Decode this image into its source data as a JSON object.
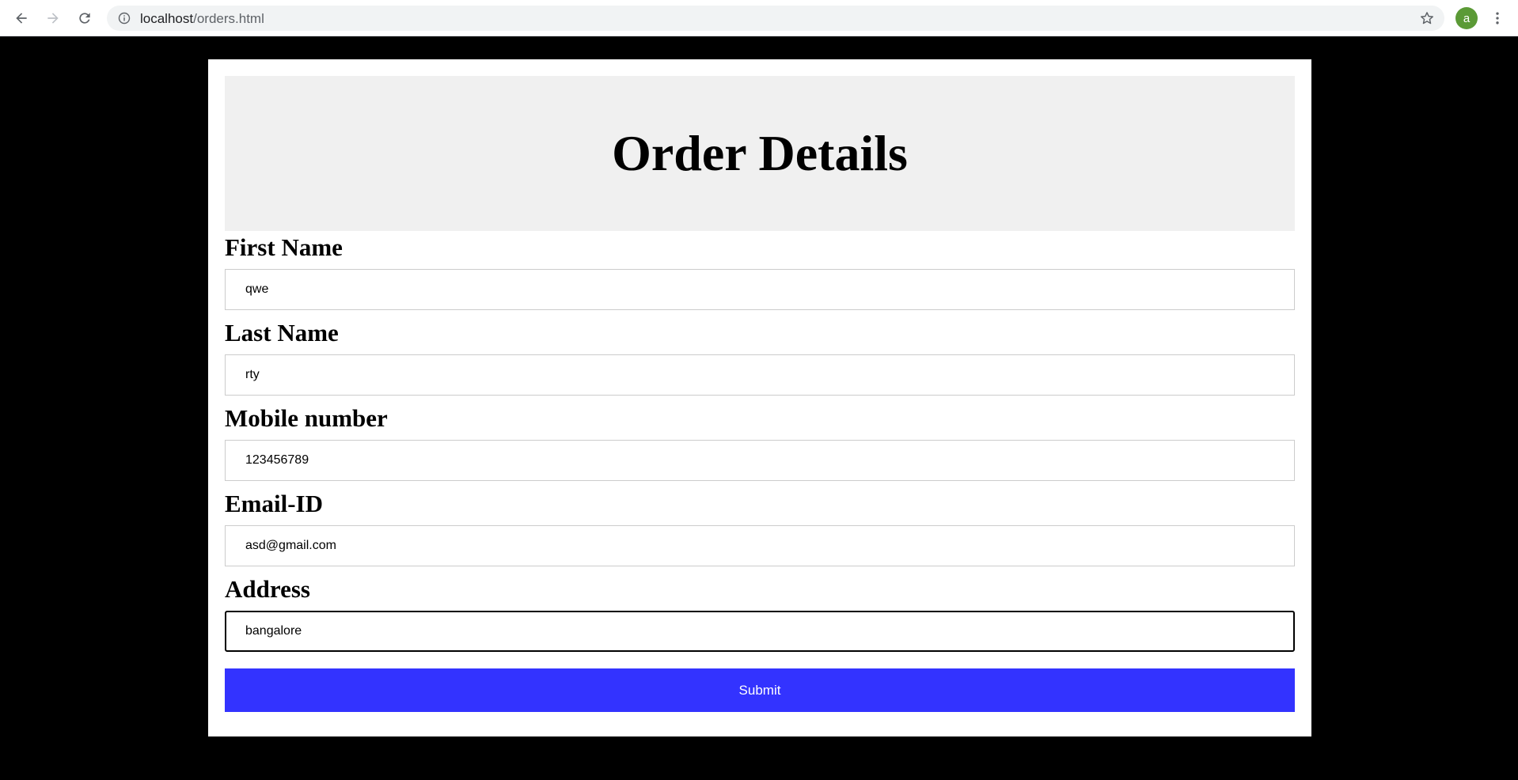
{
  "browser": {
    "url_host": "localhost",
    "url_path": "/orders.html",
    "avatar_letter": "a",
    "icons": {
      "back": "arrow-left-icon",
      "forward": "arrow-right-icon",
      "reload": "reload-icon",
      "site_info": "info-icon",
      "bookmark": "star-icon",
      "menu": "kebab-menu-icon"
    },
    "avatar_color": "#5b9a36"
  },
  "form": {
    "title": "Order Details",
    "fields": [
      {
        "label": "First Name",
        "value": "qwe"
      },
      {
        "label": "Last Name",
        "value": "rty"
      },
      {
        "label": "Mobile number",
        "value": "123456789"
      },
      {
        "label": "Email-ID",
        "value": "asd@gmail.com"
      },
      {
        "label": "Address",
        "value": "bangalore"
      }
    ],
    "submit_label": "Submit"
  },
  "colors": {
    "page_background": "#000000",
    "header_background": "#f0f0f0",
    "submit_background": "#3333ff",
    "submit_text": "#ffffff"
  }
}
